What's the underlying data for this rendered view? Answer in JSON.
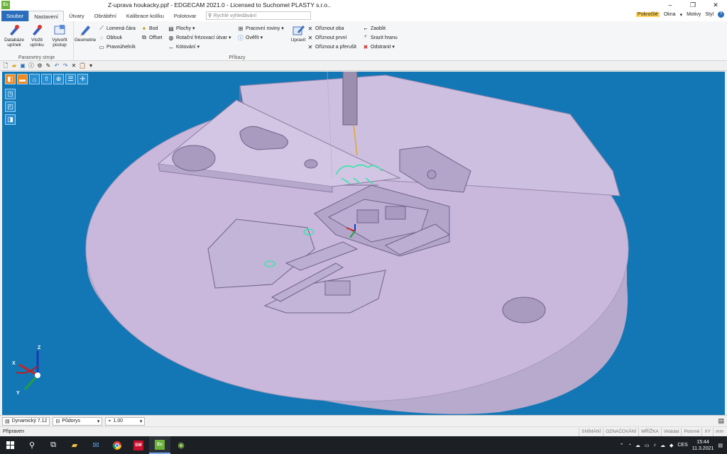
{
  "window": {
    "app_icon": "Ec",
    "title": "Z-uprava houkacky.ppf - EDGECAM 2021.0  - Licensed to Suchomel PLASTY s.r.o..",
    "controls": [
      "–",
      "❐",
      "✕"
    ]
  },
  "tabs": [
    {
      "label": "Soubor"
    },
    {
      "label": "Nastavení"
    },
    {
      "label": "Útvary"
    },
    {
      "label": "Obrábění"
    },
    {
      "label": "Kalibrace kolíku"
    },
    {
      "label": "Polotovar"
    }
  ],
  "search": {
    "placeholder": "Rychlé vyhledávání"
  },
  "right_menu": {
    "advanced": "Pokročilé",
    "windows": "Okna",
    "themes": "Motivy",
    "style": "Styl"
  },
  "ribbon": {
    "machine_params": {
      "label": "Parametry stroje",
      "fixture_db": "Databáze upínek",
      "insert_fixture": "Vložit upínku",
      "create_procedure": "Vytvořit postup"
    },
    "commands": {
      "label": "Příkazy",
      "geometry": "Geometrie",
      "polyline": "Lomená čára",
      "arc": "Oblouk",
      "rectangle": "Pravoúhelník",
      "point": "Bod",
      "offset": "Offset",
      "surfaces": "Plochy",
      "rotary": "Rotační frézovací útvar",
      "dimensioning": "Kótování",
      "work_planes": "Pracovní roviny",
      "verify": "Ověřit",
      "edit": "Upravit",
      "trim_both": "Oříznout oba",
      "trim_first": "Oříznout první",
      "trim_break": "Oříznout a přerušit",
      "fillet": "Zaoblit",
      "chamfer": "Srazit hranu",
      "remove": "Odstranit"
    }
  },
  "statusbar": {
    "view_mode": "Dynamický 7.12",
    "view": "Půdorys",
    "scale": "1.00"
  },
  "readybar": {
    "status": "Připraven",
    "indicators": [
      "SNÍMÁNÍ",
      "OZNAČOVÁNÍ",
      "MŘÍŽKA",
      "Vkládat",
      "Polomě",
      "XY",
      "mm"
    ]
  },
  "taskbar": {
    "lang": "CES",
    "time": "15:44",
    "date": "11.3.2021"
  },
  "axis": {
    "x": "X",
    "y": "Y",
    "z": "Z"
  },
  "colors": {
    "viewport_bg": "#1477b5",
    "part": "#c9b8dc",
    "accent": "#2a6ebb",
    "toolpath": "#37e6a8"
  }
}
